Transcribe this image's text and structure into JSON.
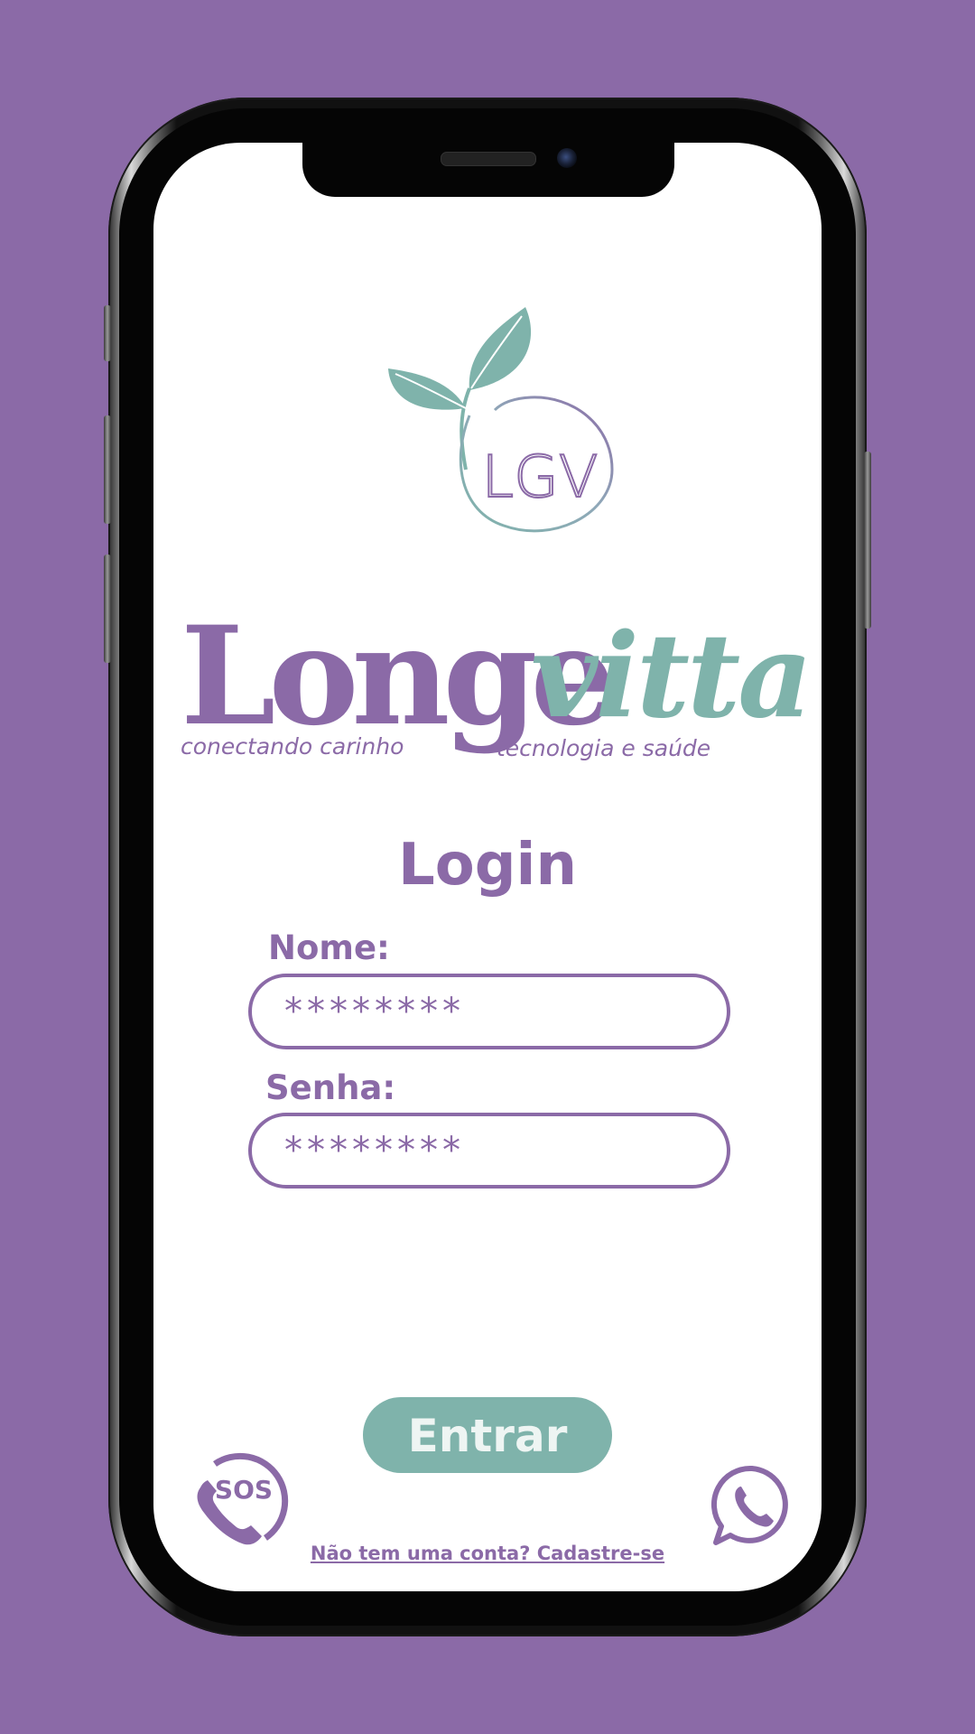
{
  "colors": {
    "background": "#8b6aa7",
    "brand_purple": "#8b6aa7",
    "brand_teal": "#7fb3ab",
    "screen": "#ffffff"
  },
  "logo": {
    "monogram": "LGV",
    "brand_part1": "Longe",
    "brand_part2": "vitta",
    "tagline_left": "conectando carinho",
    "tagline_right": "tecnologia e saúde"
  },
  "login": {
    "title": "Login",
    "name_label": "Nome:",
    "name_value": "********",
    "password_label": "Senha:",
    "password_value": "********",
    "submit_label": "Entrar",
    "signup_text": "Não tem uma conta? Cadastre-se"
  },
  "icons": {
    "sos": "sos-phone-icon",
    "sos_text": "SOS",
    "whatsapp": "whatsapp-icon"
  }
}
